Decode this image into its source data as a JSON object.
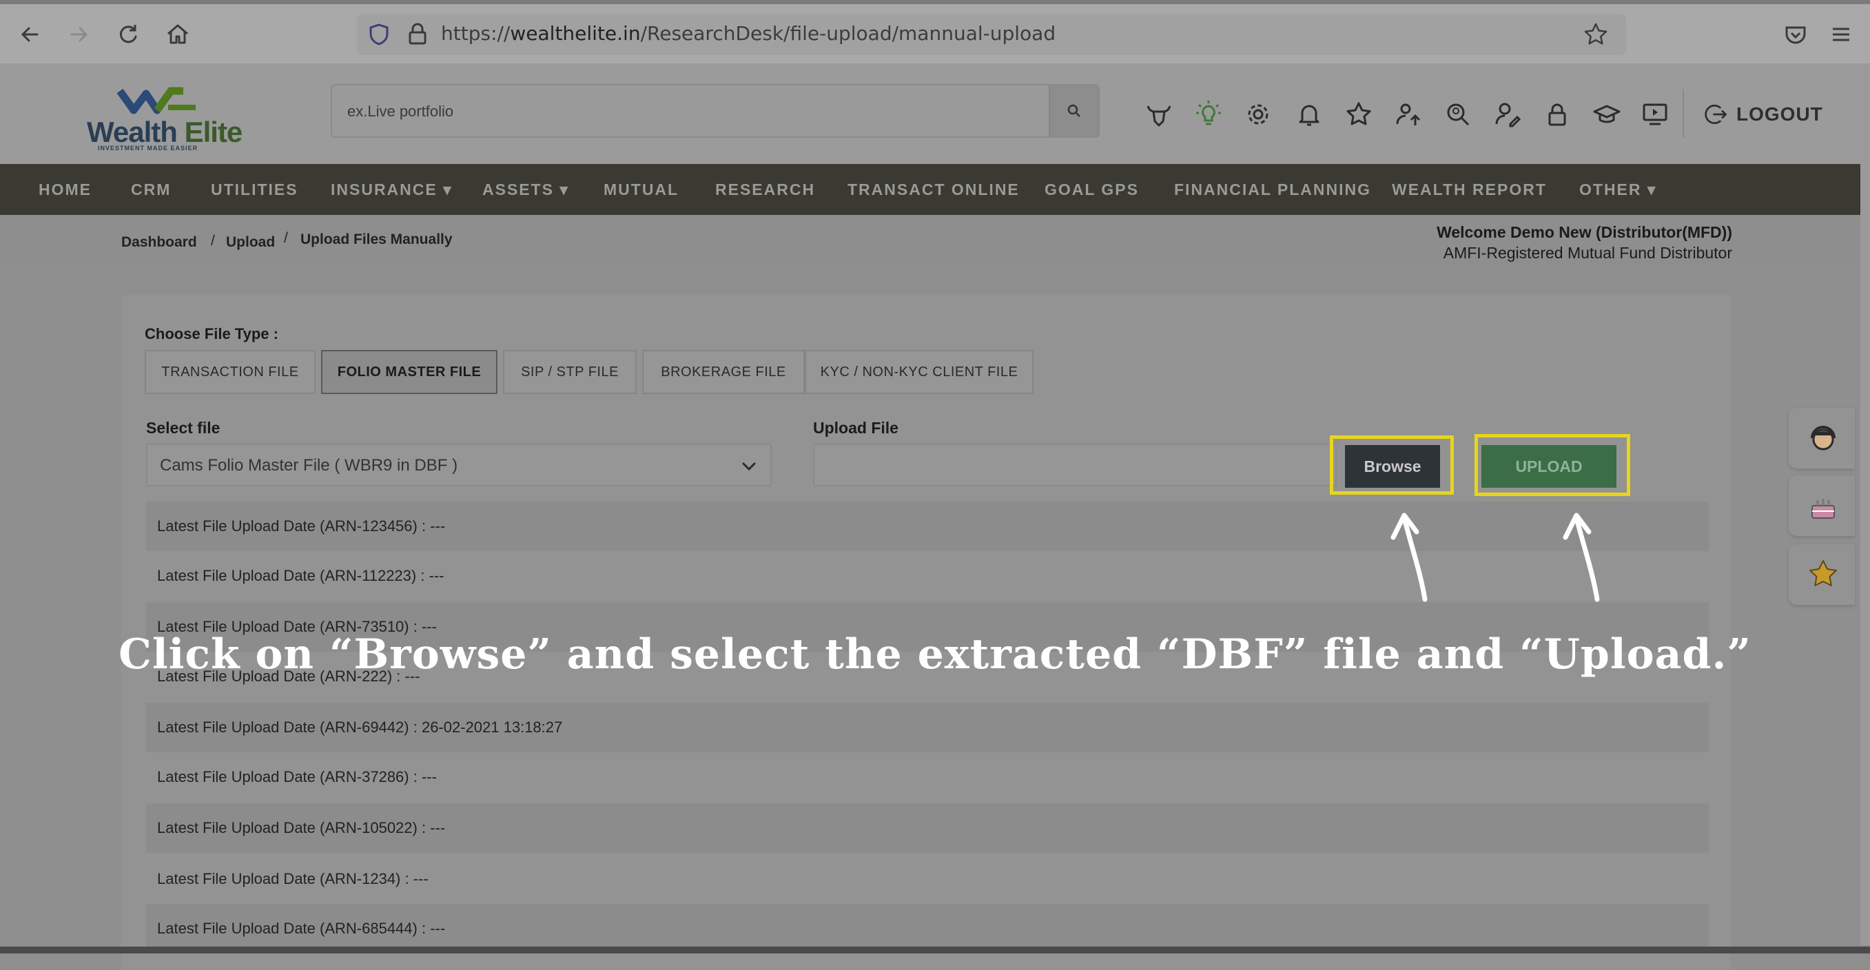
{
  "browser": {
    "url_prefix": "https://",
    "url_host": "wealthelite.in",
    "url_path": "/ResearchDesk/file-upload/mannual-upload"
  },
  "header": {
    "logo_word1": "Wealth",
    "logo_word2": "Elite",
    "logo_tagline": "INVESTMENT MADE EASIER",
    "search_placeholder": "ex.Live portfolio",
    "logout_label": "LOGOUT"
  },
  "nav": {
    "items": [
      "HOME",
      "CRM",
      "UTILITIES",
      "INSURANCE ▾",
      "ASSETS ▾",
      "MUTUAL",
      "RESEARCH",
      "TRANSACT ONLINE",
      "GOAL GPS",
      "FINANCIAL PLANNING",
      "WEALTH REPORT",
      "OTHER ▾"
    ]
  },
  "breadcrumb": {
    "items": [
      "Dashboard",
      "/",
      "Upload",
      "/",
      "Upload Files Manually"
    ]
  },
  "welcome": {
    "name": "Welcome Demo New (Distributor(MFD))",
    "role": "AMFI-Registered Mutual Fund Distributor"
  },
  "form": {
    "choose_label": "Choose File Type :",
    "file_types": [
      "TRANSACTION FILE",
      "FOLIO MASTER FILE",
      "SIP / STP FILE",
      "BROKERAGE FILE",
      "KYC / NON-KYC CLIENT FILE"
    ],
    "active_file_type": "FOLIO MASTER FILE",
    "select_label": "Select file",
    "select_value": "Cams Folio Master File ( WBR9 in DBF )",
    "upload_label": "Upload File",
    "browse_label": "Browse",
    "upload_button": "UPLOAD"
  },
  "uploads": [
    "Latest File Upload Date (ARN-123456) : ---",
    "Latest File Upload Date (ARN-112223) : ---",
    "Latest File Upload Date (ARN-73510) : ---",
    "Latest File Upload Date (ARN-222) : ---",
    "Latest File Upload Date (ARN-69442) : 26-02-2021 13:18:27",
    "Latest File Upload Date (ARN-37286) : ---",
    "Latest File Upload Date (ARN-105022) : ---",
    "Latest File Upload Date (ARN-1234) : ---",
    "Latest File Upload Date (ARN-685444) : ---"
  ],
  "overlay": {
    "caption": "Click on “Browse” and select the extracted “DBF” file and “Upload.”",
    "highlight_color": "#e8d51b"
  },
  "colors": {
    "nav_bg": "#3a3a32",
    "upload_green": "#3b6e47",
    "browse_dark": "#2e3338"
  }
}
